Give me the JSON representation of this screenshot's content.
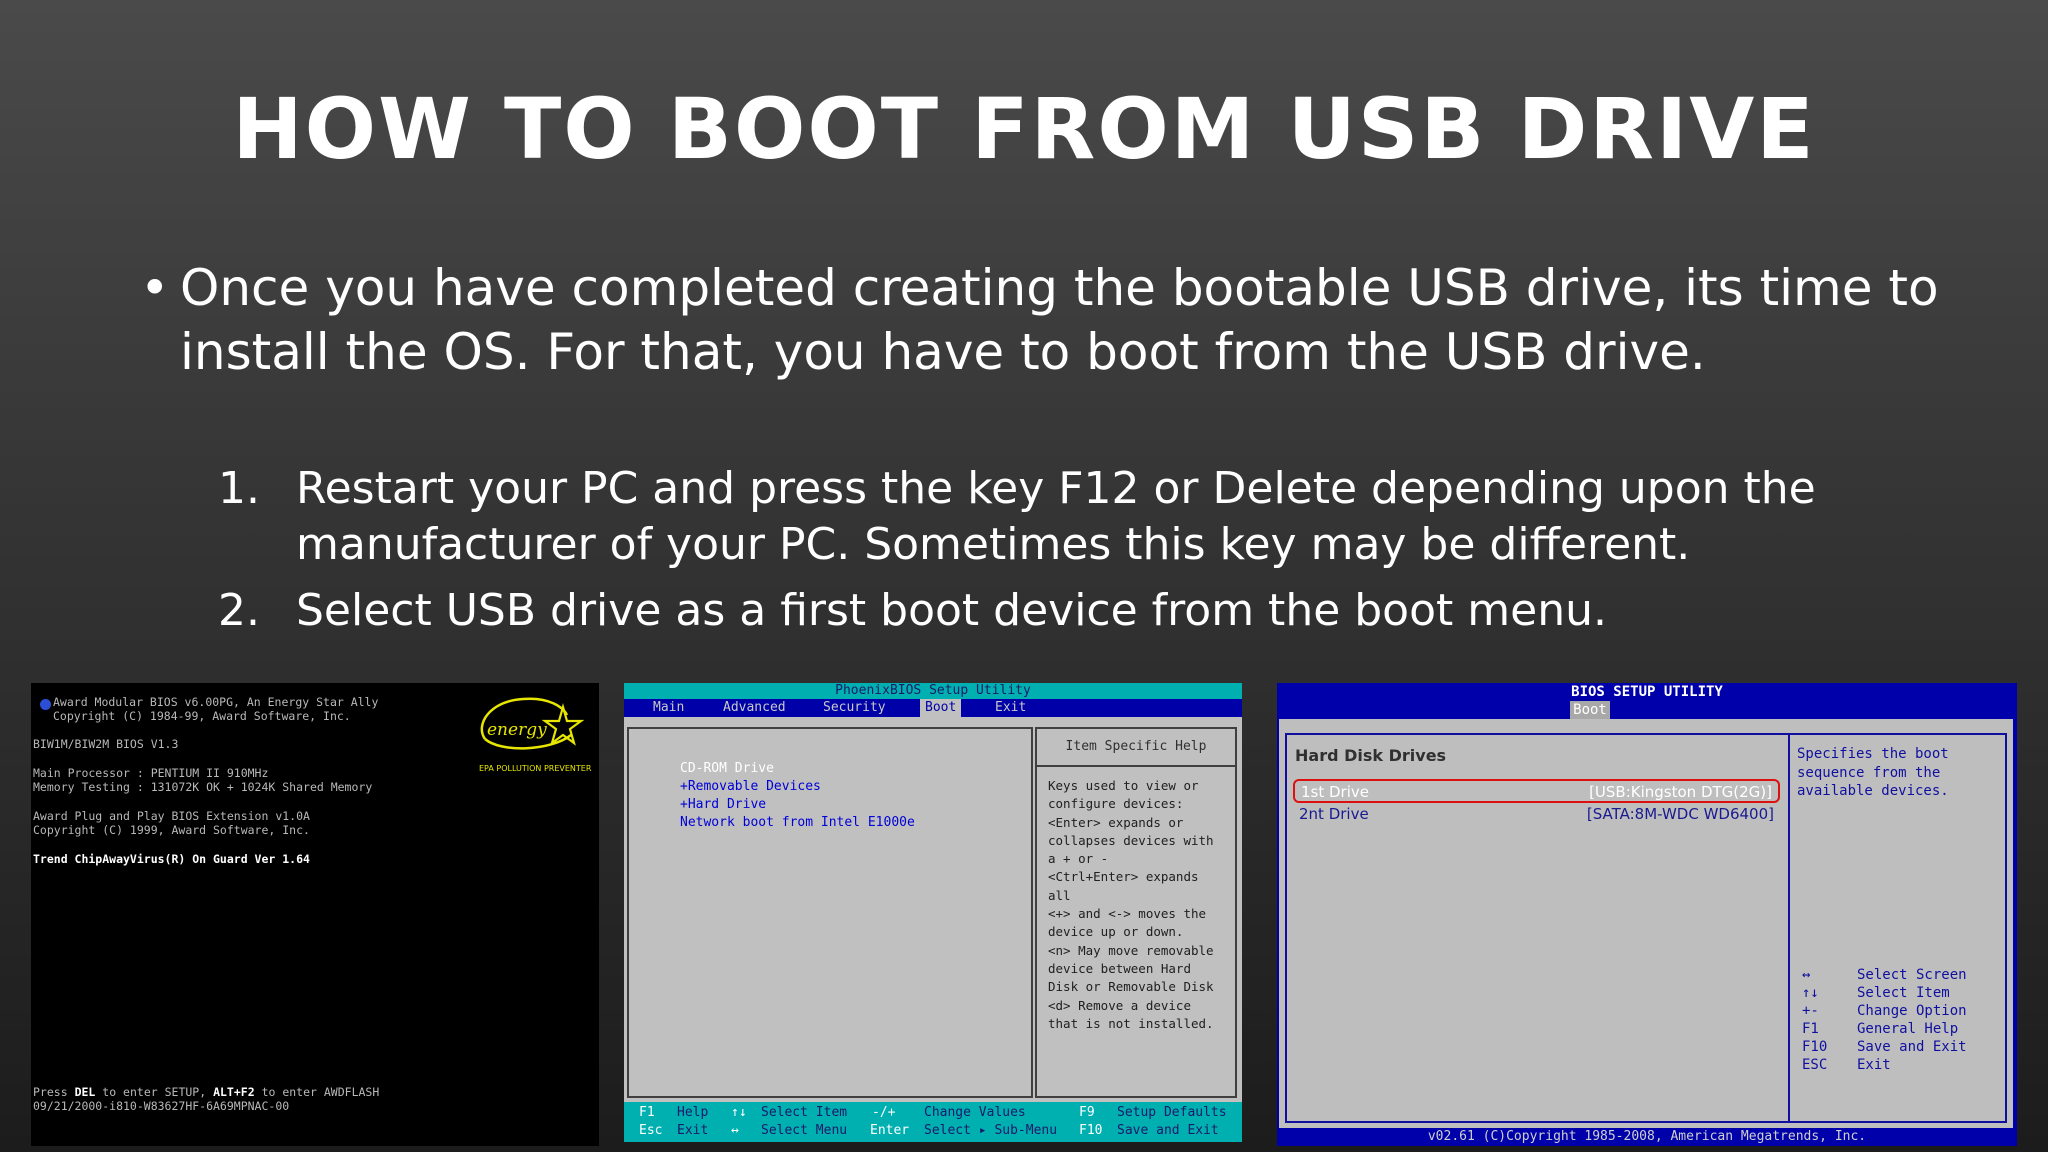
{
  "slide": {
    "title": "HOW TO BOOT FROM USB DRIVE",
    "bullet_symbol": "•",
    "bullet": "Once you have completed creating the bootable USB drive, its time to install the OS. For that, you have to boot from the USB drive.",
    "steps": [
      {
        "num": "1.",
        "text": "Restart your PC and press the key F12 or Delete depending upon the manufacturer of your PC. Sometimes this key may be different."
      },
      {
        "num": "2.",
        "text": "Select USB drive as a first boot device from the boot menu."
      }
    ]
  },
  "award_bios": {
    "lines": [
      "Award Modular BIOS v6.00PG, An Energy Star Ally",
      "Copyright (C) 1984-99, Award Software, Inc.",
      "BIW1M/BIW2M BIOS V1.3",
      "Main Processor : PENTIUM II 910MHz",
      "Memory Testing :  131072K OK + 1024K Shared Memory",
      "Award Plug and Play BIOS Extension v1.0A",
      "Copyright (C) 1999, Award Software, Inc.",
      "Trend ChipAwayVirus(R) On Guard Ver 1.64"
    ],
    "footer_press": "Press",
    "footer_del": "DEL",
    "footer_mid": "to enter SETUP,",
    "footer_altf2": "ALT+F2",
    "footer_end": "to enter AWDFLASH",
    "footer_line2": "09/21/2000-i810-W83627HF-6A69MPNAC-00",
    "energy_logo_text": "energy",
    "energy_caption": "EPA POLLUTION PREVENTER"
  },
  "phoenix_bios": {
    "title": "PhoenixBIOS Setup Utility",
    "menu": [
      "Main",
      "Advanced",
      "Security",
      "Boot",
      "Exit"
    ],
    "active_menu": "Boot",
    "boot_items": [
      "CD-ROM Drive",
      "+Removable Devices",
      "+Hard Drive",
      "Network boot from Intel E1000e"
    ],
    "help_title": "Item Specific Help",
    "help_text": "Keys used to view or\nconfigure devices:\n<Enter> expands or\ncollapses devices with\na + or -\n<Ctrl+Enter> expands\nall\n<+> and <-> moves the\ndevice up or down.\n<n> May move removable\ndevice between Hard\nDisk or Removable Disk\n<d> Remove a device\nthat is not installed.",
    "footer": {
      "f1": "F1",
      "help": "Help",
      "ud_keys": "↑↓",
      "select_item": "Select Item",
      "pm_keys": "-/+",
      "change_values": "Change Values",
      "f9": "F9",
      "setup_defaults": "Setup Defaults",
      "esc": "Esc",
      "exit": "Exit",
      "lr_keys": "↔",
      "select_menu": "Select Menu",
      "enter": "Enter",
      "select_submenu": "Select ▸ Sub-Menu",
      "f10": "F10",
      "save_exit": "Save and Exit"
    }
  },
  "ami_bios": {
    "title": "BIOS SETUP UTILITY",
    "tab": "Boot",
    "section": "Hard Disk Drives",
    "drives": [
      {
        "label": "1st Drive",
        "value": "[USB:Kingston DTG(2G)]",
        "selected": true
      },
      {
        "label": "2nt Drive",
        "value": "[SATA:8M-WDC WD6400]",
        "selected": false
      }
    ],
    "help": "Specifies the boot\nsequence from the\navailable devices.",
    "keys": [
      {
        "key": "↔",
        "action": "Select Screen"
      },
      {
        "key": "↑↓",
        "action": "Select Item"
      },
      {
        "key": "+-",
        "action": "Change Option"
      },
      {
        "key": "F1",
        "action": "General Help"
      },
      {
        "key": "F10",
        "action": "Save and Exit"
      },
      {
        "key": "ESC",
        "action": "Exit"
      }
    ],
    "footer": "v02.61 (C)Copyright 1985-2008, American Megatrends, Inc."
  },
  "colors": {
    "phoenix_bar": "#00b0b0",
    "phoenix_menu": "#0000a8",
    "ami_blue": "#0000aa",
    "ami_highlight": "#dd1010",
    "energy_yellow": "#e6e600"
  }
}
